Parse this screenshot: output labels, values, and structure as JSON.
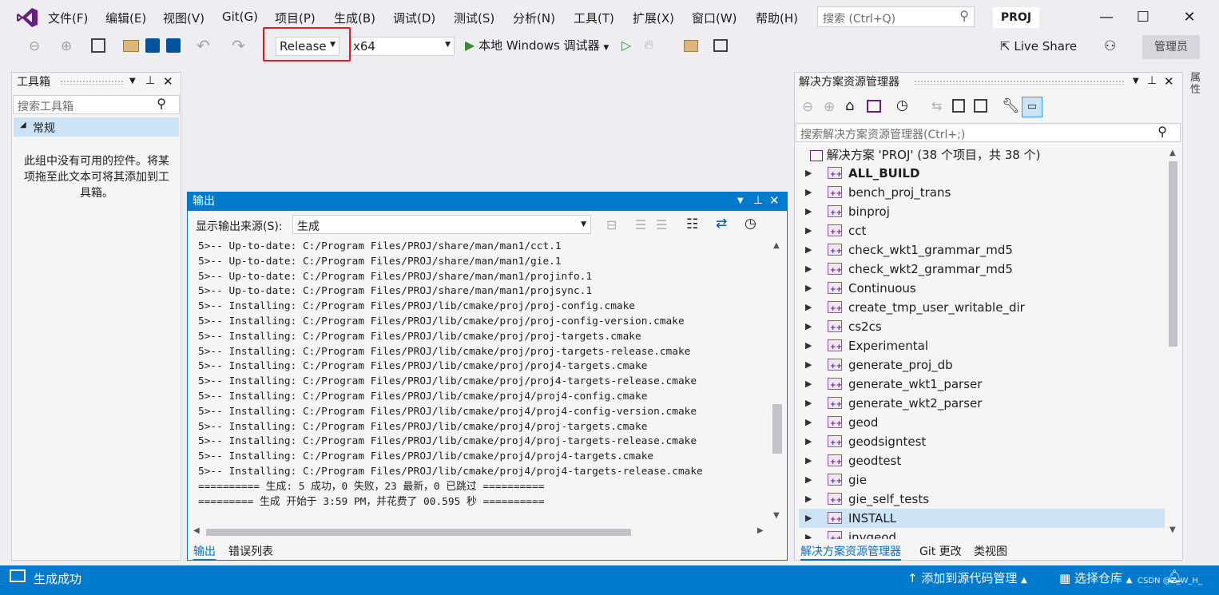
{
  "menu": [
    "文件(F)",
    "编辑(E)",
    "视图(V)",
    "Git(G)",
    "项目(P)",
    "生成(B)",
    "调试(D)",
    "测试(S)",
    "分析(N)",
    "工具(T)",
    "扩展(X)",
    "窗口(W)",
    "帮助(H)"
  ],
  "search": {
    "placeholder": "搜索 (Ctrl+Q)"
  },
  "project_badge": "PROJ",
  "toolbar": {
    "configuration": "Release",
    "platform": "x64",
    "debugger": "本地 Windows 调试器",
    "live_share": "Live Share",
    "admin": "管理员"
  },
  "toolbox": {
    "title": "工具箱",
    "search_placeholder": "搜索工具箱",
    "group": "常规",
    "empty_message": "此组中没有可用的控件。将某项拖至此文本可将其添加到工具箱。"
  },
  "output": {
    "title": "输出",
    "source_label": "显示输出来源(S):",
    "source_value": "生成",
    "lines": [
      "5>-- Up-to-date: C:/Program Files/PROJ/share/man/man1/cct.1",
      "5>-- Up-to-date: C:/Program Files/PROJ/share/man/man1/gie.1",
      "5>-- Up-to-date: C:/Program Files/PROJ/share/man/man1/projinfo.1",
      "5>-- Up-to-date: C:/Program Files/PROJ/share/man/man1/projsync.1",
      "5>-- Installing: C:/Program Files/PROJ/lib/cmake/proj/proj-config.cmake",
      "5>-- Installing: C:/Program Files/PROJ/lib/cmake/proj/proj-config-version.cmake",
      "5>-- Installing: C:/Program Files/PROJ/lib/cmake/proj/proj-targets.cmake",
      "5>-- Installing: C:/Program Files/PROJ/lib/cmake/proj/proj-targets-release.cmake",
      "5>-- Installing: C:/Program Files/PROJ/lib/cmake/proj/proj4-targets.cmake",
      "5>-- Installing: C:/Program Files/PROJ/lib/cmake/proj/proj4-targets-release.cmake",
      "5>-- Installing: C:/Program Files/PROJ/lib/cmake/proj4/proj4-config.cmake",
      "5>-- Installing: C:/Program Files/PROJ/lib/cmake/proj4/proj4-config-version.cmake",
      "5>-- Installing: C:/Program Files/PROJ/lib/cmake/proj4/proj-targets.cmake",
      "5>-- Installing: C:/Program Files/PROJ/lib/cmake/proj4/proj-targets-release.cmake",
      "5>-- Installing: C:/Program Files/PROJ/lib/cmake/proj4/proj4-targets.cmake",
      "5>-- Installing: C:/Program Files/PROJ/lib/cmake/proj4/proj4-targets-release.cmake",
      "========== 生成: 5 成功，0 失败，23 最新，0 已跳过 ==========",
      "========= 生成 开始于 3:59 PM，并花费了 00.595 秒 =========="
    ],
    "tabs": [
      "输出",
      "错误列表"
    ]
  },
  "solution": {
    "title": "解决方案资源管理器",
    "search_placeholder": "搜索解决方案资源管理器(Ctrl+;)",
    "root": "解决方案 'PROJ' (38 个项目，共 38 个)",
    "items": [
      "ALL_BUILD",
      "bench_proj_trans",
      "binproj",
      "cct",
      "check_wkt1_grammar_md5",
      "check_wkt2_grammar_md5",
      "Continuous",
      "create_tmp_user_writable_dir",
      "cs2cs",
      "Experimental",
      "generate_proj_db",
      "generate_wkt1_parser",
      "generate_wkt2_parser",
      "geod",
      "geodsigntest",
      "geodtest",
      "gie",
      "gie_self_tests",
      "INSTALL",
      "invgeod"
    ],
    "tabs": [
      "解决方案资源管理器",
      "Git 更改",
      "类视图"
    ]
  },
  "right_edge_tab": "属性",
  "status": {
    "message": "生成成功",
    "add_to_source": "添加到源代码管理",
    "select_repo": "选择仓库",
    "watermark": "CSDN @Z_W_H_"
  },
  "colors": {
    "accent": "#007acc",
    "highlight_box": "#e51c1c",
    "selected_row": "#cce3f5"
  }
}
